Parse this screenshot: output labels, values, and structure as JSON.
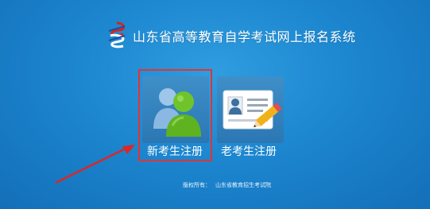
{
  "header": {
    "title": "山东省高等教育自学考试网上报名系统"
  },
  "tiles": {
    "new": {
      "label": "新考生注册",
      "icon": "users-icon"
    },
    "old": {
      "label": "老考生注册",
      "icon": "id-card-edit-icon"
    }
  },
  "footer": {
    "copyright_label": "版权所有：",
    "copyright_owner": "山东省教育招生考试院"
  },
  "colors": {
    "highlight": "#e23434",
    "background": "#1c86cf"
  }
}
